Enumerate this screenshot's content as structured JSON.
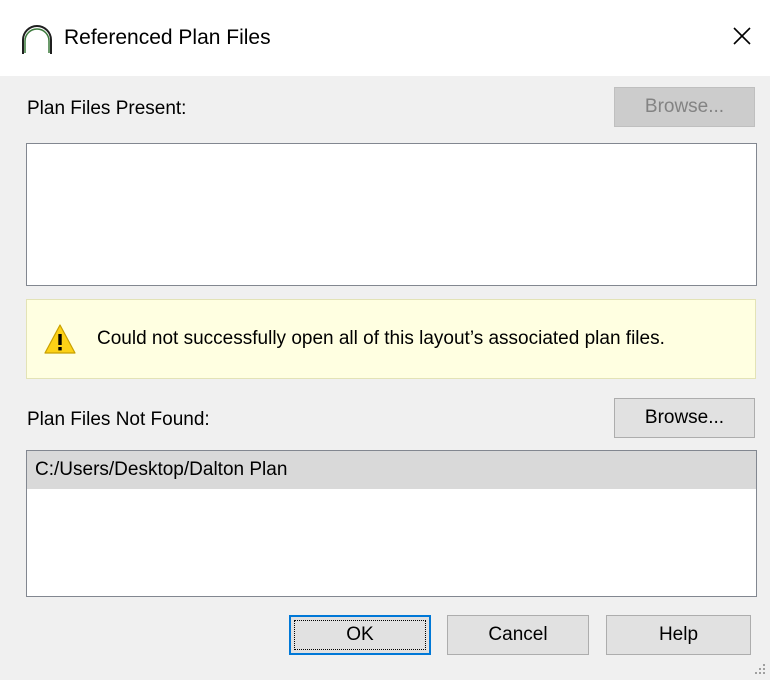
{
  "window": {
    "title": "Referenced Plan Files",
    "icon": "arc-icon",
    "close_glyph": "✕"
  },
  "present": {
    "label": "Plan Files Present:",
    "browse_label": "Browse...",
    "browse_enabled": false,
    "items": []
  },
  "warning": {
    "icon": "warning-icon",
    "message": "Could not successfully open all of this layout’s associated plan files."
  },
  "not_found": {
    "label": "Plan Files Not Found:",
    "browse_label": "Browse...",
    "items": [
      {
        "path": "C:/Users/Desktop/Dalton Plan",
        "selected": true
      }
    ]
  },
  "buttons": {
    "ok": "OK",
    "cancel": "Cancel",
    "help": "Help"
  },
  "colors": {
    "warning_background": "#ffffe1",
    "warning_triangle": "#fcd116",
    "selection": "#d9d9d9",
    "default_button_border": "#0078d7",
    "title_icon_stroke": "#3c7a3c"
  }
}
